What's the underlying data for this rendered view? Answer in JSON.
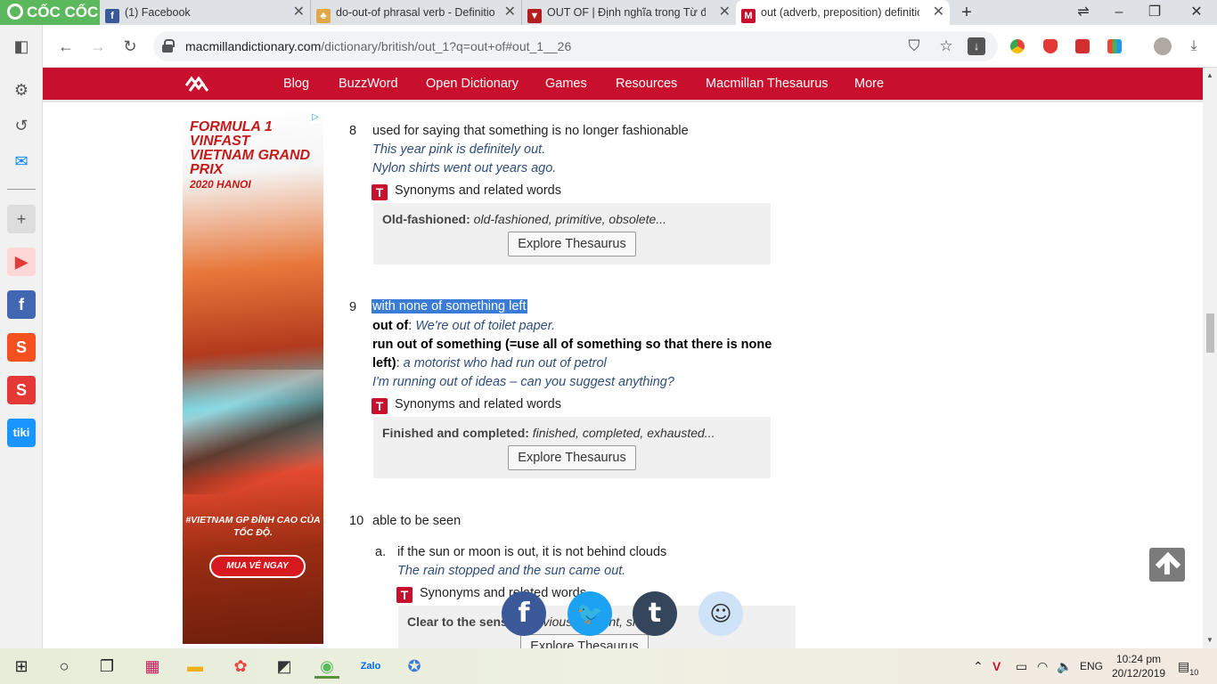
{
  "browser": {
    "brand": "CỐC CỐC",
    "tabs": [
      {
        "title": "(1) Facebook",
        "icon": "facebook-icon",
        "color": "#3b5998"
      },
      {
        "title": "do-out-of phrasal verb - Definition",
        "icon": "dictionary-icon",
        "color": "#e0a84a"
      },
      {
        "title": "OUT OF | Định nghĩa trong Từ điển",
        "icon": "cambridge-shield-icon",
        "color": "#b41e1e"
      },
      {
        "title": "out (adverb, preposition) definition",
        "icon": "macmillan-icon",
        "color": "#c8102e"
      }
    ],
    "url_host": "macmillandictionary.com",
    "url_path": "/dictionary/british/out_1?q=out+of#out_1__26"
  },
  "site": {
    "nav": [
      "Blog",
      "BuzzWord",
      "Open Dictionary",
      "Games",
      "Resources",
      "Macmillan Thesaurus",
      "More"
    ]
  },
  "ad": {
    "title": "FORMULA 1 VINFAST VIETNAM GRAND PRIX",
    "year": "2020 HANOI",
    "hashtag": "#VIETNAM GP ĐỈNH CAO CỦA TỐC ĐỘ.",
    "cta": "MUA VÉ NGAY"
  },
  "entries": {
    "e8": {
      "num": "8",
      "def": "used for saying that something is no longer fashionable",
      "ex1": "This year pink is definitely out.",
      "ex2": "Nylon shirts went out years ago.",
      "syn": "Synonyms and related words",
      "thes_head": "Old-fashioned:",
      "thes_words": "old-fashioned, primitive, obsolete...",
      "btn": "Explore Thesaurus"
    },
    "e9": {
      "num": "9",
      "def": "with none of something left",
      "p1": "out of",
      "p1_sep": ": ",
      "ex1": "We're out of toilet paper.",
      "p2a": "run out of something (=use all of something so that there is none",
      "p2b": "left)",
      "p2_sep": ": ",
      "ex2": "a motorist who had run out of petrol",
      "ex3": "I'm running out of ideas – can you suggest anything?",
      "syn": "Synonyms and related words",
      "thes_head": "Finished and completed:",
      "thes_words": "finished, completed, exhausted...",
      "btn": "Explore Thesaurus"
    },
    "e10": {
      "num": "10",
      "def": "able to be seen",
      "sub": "a.",
      "subdef": "if the sun or moon is out, it is not behind clouds",
      "ex1": "The rain stopped and the sun came out.",
      "syn": "Synonyms and related words",
      "thes_head": "Clear to the senses:",
      "thes_words": "obvious, evident, sharp...",
      "btn": "Explore Thesaurus"
    }
  },
  "share": [
    "facebook-icon",
    "twitter-icon",
    "tumblr-icon",
    "reddit-icon"
  ],
  "taskbar": {
    "lang": "ENG",
    "time": "10:24 pm",
    "date": "20/12/2019",
    "notifications": "10"
  }
}
